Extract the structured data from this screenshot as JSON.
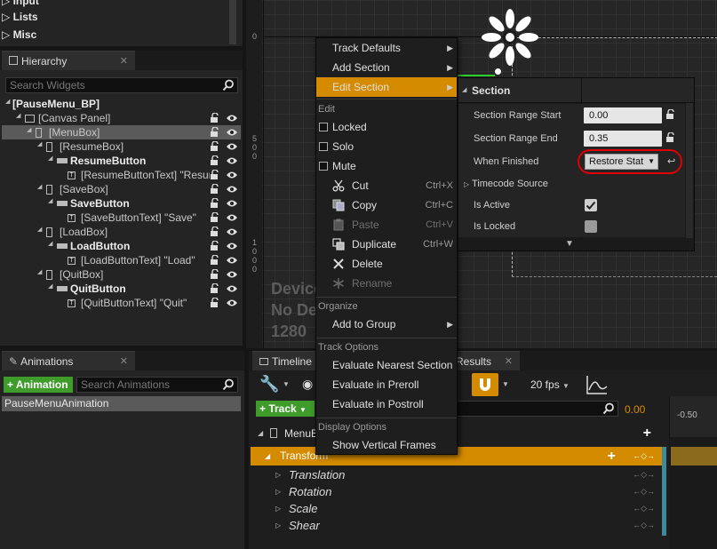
{
  "palette": {
    "sections": [
      "Input",
      "Lists",
      "Misc"
    ]
  },
  "hierarchy": {
    "tab_label": "Hierarchy",
    "search_placeholder": "Search Widgets",
    "tree": [
      "[PauseMenu_BP]",
      "[Canvas Panel]",
      "[MenuBox]",
      "[ResumeBox]",
      "ResumeButton",
      "[ResumeButtonText] \"Resum",
      "[SaveBox]",
      "SaveButton",
      "[SaveButtonText] \"Save\"",
      "[LoadBox]",
      "LoadButton",
      "[LoadButtonText] \"Load\"",
      "[QuitBox]",
      "QuitButton",
      "[QuitButtonText] \"Quit\""
    ]
  },
  "animations": {
    "tab_label": "Animations",
    "add_label": "+ Animation",
    "search_placeholder": "Search Animations",
    "items": [
      "PauseMenuAnimation"
    ]
  },
  "viewport": {
    "ruler_marks": [
      "0",
      "5\n0\n0",
      "1\n0\n0\n0"
    ],
    "device_lines": [
      "Device",
      "No De",
      "1280"
    ]
  },
  "context_menu": {
    "top_items": [
      "Track Defaults",
      "Add Section",
      "Edit Section"
    ],
    "edit_header": "Edit",
    "toggles": [
      "Locked",
      "Solo",
      "Mute"
    ],
    "actions": [
      {
        "label": "Cut",
        "shortcut": "Ctrl+X",
        "icon": "cut-icon"
      },
      {
        "label": "Copy",
        "shortcut": "Ctrl+C",
        "icon": "copy-icon"
      },
      {
        "label": "Paste",
        "shortcut": "Ctrl+V",
        "icon": "paste-icon"
      },
      {
        "label": "Duplicate",
        "shortcut": "Ctrl+W",
        "icon": "duplicate-icon"
      },
      {
        "label": "Delete",
        "shortcut": "",
        "icon": "delete-icon"
      },
      {
        "label": "Rename",
        "shortcut": "",
        "icon": "rename-icon"
      }
    ],
    "organize_header": "Organize",
    "add_to_group": "Add to Group",
    "track_options_header": "Track Options",
    "track_options": [
      "Evaluate Nearest Section",
      "Evaluate in Preroll",
      "Evaluate in Postroll"
    ],
    "display_options_header": "Display Options",
    "display_options": [
      "Show Vertical Frames"
    ]
  },
  "section_panel": {
    "title": "Section",
    "range_start_label": "Section Range Start",
    "range_start_value": "0.00",
    "range_end_label": "Section Range End",
    "range_end_value": "0.35",
    "when_finished_label": "When Finished",
    "when_finished_value": "Restore Stat",
    "timecode_label": "Timecode Source",
    "is_active_label": "Is Active",
    "is_active": true,
    "is_locked_label": "Is Locked",
    "is_locked": false
  },
  "timeline": {
    "tab_label": "Timeline",
    "results_tab": "Results",
    "fps_label": "20 fps",
    "track_button": "+ Track",
    "time_value": "0.00",
    "ruler_value": "-0.50",
    "menubox_label": "MenuB",
    "transform_label": "Transform",
    "sub_tracks": [
      "Translation",
      "Rotation",
      "Scale",
      "Shear"
    ]
  },
  "colors": {
    "accent": "#d58b00",
    "green": "#3f9b2a",
    "highlight_red": "#e00000",
    "teal": "#3e8a99"
  }
}
